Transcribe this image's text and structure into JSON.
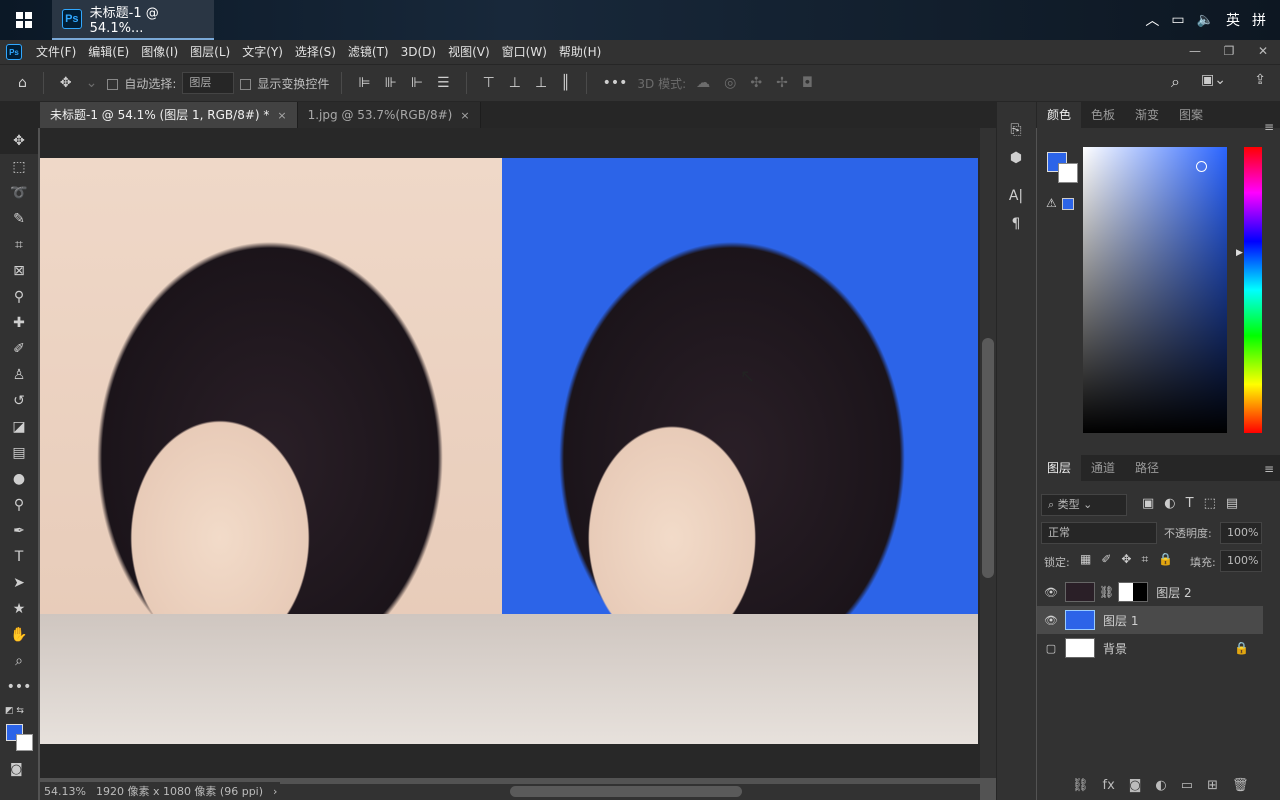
{
  "taskbar": {
    "title": "未标题-1 @ 54.1%...",
    "ps": "Ps",
    "tray": {
      "lang": "英",
      "ime": "拼"
    }
  },
  "menu": [
    "文件(F)",
    "编辑(E)",
    "图像(I)",
    "图层(L)",
    "文字(Y)",
    "选择(S)",
    "滤镜(T)",
    "3D(D)",
    "视图(V)",
    "窗口(W)",
    "帮助(H)"
  ],
  "options": {
    "auto_select": "自动选择:",
    "layer_select": "图层",
    "show_transform": "显示变换控件",
    "mode3d": "3D 模式:"
  },
  "tabs": [
    {
      "label": "未标题-1 @ 54.1% (图层 1, RGB/8#) *",
      "close": "×"
    },
    {
      "label": "1.jpg @ 53.7%(RGB/8#)",
      "close": "×"
    }
  ],
  "status": {
    "zoom": "54.13%",
    "size": "1920 像素 x 1080 像素 (96 ppi)",
    "arrow": "›"
  },
  "color_panel": {
    "tabs": [
      "颜色",
      "色板",
      "渐变",
      "图案"
    ],
    "fg": "#2c64e8",
    "bg": "#ffffff"
  },
  "layers_panel": {
    "tabs": [
      "图层",
      "通道",
      "路径"
    ],
    "filter": "类型",
    "blend": "正常",
    "opacity_label": "不透明度:",
    "opacity": "100%",
    "lock_label": "锁定:",
    "fill_label": "填充:",
    "fill": "100%",
    "layers": [
      {
        "name": "图层 2"
      },
      {
        "name": "图层 1"
      },
      {
        "name": "背景"
      }
    ]
  },
  "icons": {
    "home": "⌂",
    "move": "✥",
    "more": "•••",
    "search": "⌕"
  }
}
